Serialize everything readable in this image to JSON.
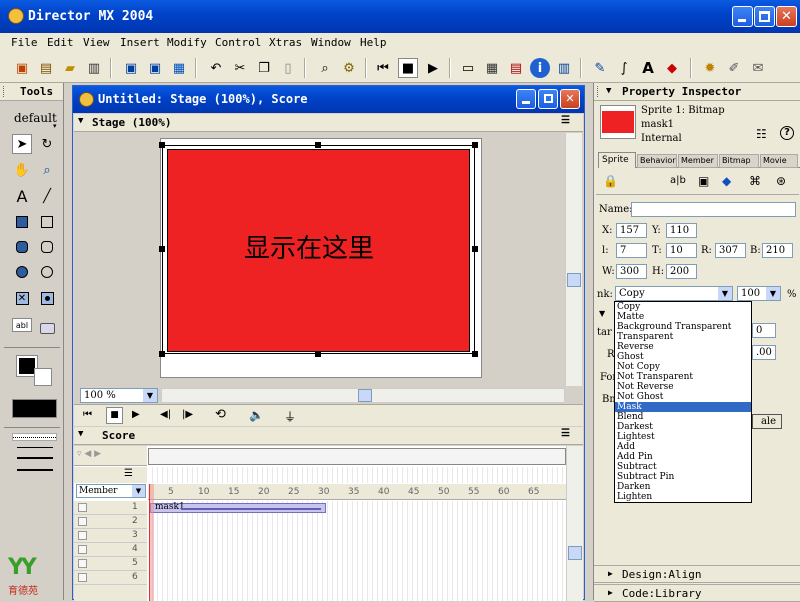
{
  "app": {
    "title": "Director MX 2004"
  },
  "menu": [
    "File",
    "Edit",
    "View",
    "Insert",
    "Modify",
    "Control",
    "Xtras",
    "Window",
    "Help"
  ],
  "tools": {
    "title": "Tools",
    "mode": "default"
  },
  "stage_window": {
    "title": "Untitled: Stage (100%), Score",
    "stage_label": "Stage (100%)",
    "zoom": "100 %",
    "sprite_text": "显示在这里",
    "sprite_color": "#ee2222"
  },
  "score": {
    "label": "Score",
    "channel_select": "Member",
    "frame_ticks": [
      "5",
      "10",
      "15",
      "20",
      "25",
      "30",
      "35",
      "40",
      "45",
      "50",
      "55",
      "60",
      "65"
    ],
    "channels": [
      "1",
      "2",
      "3",
      "4",
      "5",
      "6"
    ],
    "sprite_name": "mask1"
  },
  "inspector": {
    "title": "Property Inspector",
    "sprite_line": "Sprite 1: Bitmap",
    "member_name": "mask1",
    "cast": "Internal",
    "tabs": [
      "Sprite",
      "Behavior",
      "Member",
      "Bitmap",
      "Movie"
    ],
    "name_label": "Name:",
    "x_label": "X:",
    "x": "157",
    "y_label": "Y:",
    "y": "110",
    "l_label": "l:",
    "l": "7",
    "t_label": "T:",
    "t": "10",
    "r_label": "R:",
    "r": "307",
    "b_label": "B:",
    "b": "210",
    "w_label": "W:",
    "w": "300",
    "h_label": "H:",
    "h": "200",
    "ink_label": "nk:",
    "ink": "Copy",
    "blend": "100",
    "blend_unit": "%",
    "partial_right1": "0",
    "partial_right2": ".00",
    "partial_left1": "tar",
    "partial_left2": "Re",
    "partial_left3": "For",
    "partial_left4": "Bm",
    "partial_button": "ale",
    "design_panel": "Design:Align",
    "code_panel": "Code:Library"
  },
  "ink_options": [
    "Copy",
    "Matte",
    "Background Transparent",
    "Transparent",
    "Reverse",
    "Ghost",
    "Not Copy",
    "Not Transparent",
    "Not Reverse",
    "Not Ghost",
    "Mask",
    "Blend",
    "Darkest",
    "Lightest",
    "Add",
    "Add Pin",
    "Subtract",
    "Subtract Pin",
    "Darken",
    "Lighten"
  ],
  "ink_selected": "Mask",
  "logo_text": "育德苑"
}
